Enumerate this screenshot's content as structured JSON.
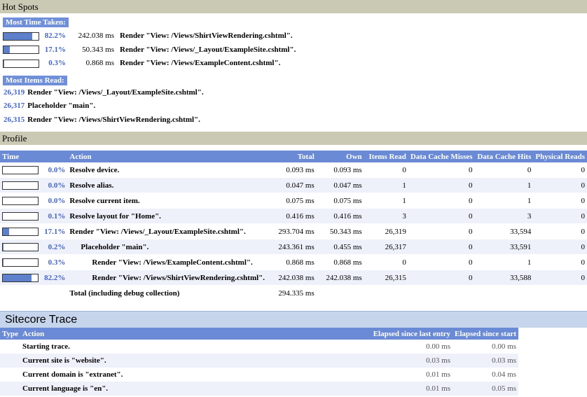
{
  "hotspots": {
    "title": "Hot Spots",
    "time_tag": "Most Time Taken:",
    "time_rows": [
      {
        "pct": "82.2%",
        "fill": 0.822,
        "ms": "242.038 ms",
        "label": "Render \"View: /Views/ShirtViewRendering.cshtml\"."
      },
      {
        "pct": "17.1%",
        "fill": 0.171,
        "ms": "50.343 ms",
        "label": "Render \"View: /Views/_Layout/ExampleSite.cshtml\"."
      },
      {
        "pct": "0.3%",
        "fill": 0.003,
        "ms": "0.868 ms",
        "label": "Render \"View: /Views/ExampleContent.cshtml\"."
      }
    ],
    "items_tag": "Most Items Read:",
    "items_rows": [
      {
        "count": "26,319",
        "label": "Render \"View: /Views/_Layout/ExampleSite.cshtml\"."
      },
      {
        "count": "26,317",
        "label": "Placeholder \"main\"."
      },
      {
        "count": "26,315",
        "label": "Render \"View: /Views/ShirtViewRendering.cshtml\"."
      }
    ]
  },
  "profile": {
    "title": "Profile",
    "headers": {
      "time": "Time",
      "action": "Action",
      "total": "Total",
      "own": "Own",
      "items_read": "Items Read",
      "cache_misses": "Data Cache Misses",
      "cache_hits": "Data Cache Hits",
      "physical_reads": "Physical Reads"
    },
    "rows": [
      {
        "pct": "0.0%",
        "fill": 0.0,
        "indent": 0,
        "action": "Resolve device.",
        "total": "0.093 ms",
        "own": "0.093 ms",
        "items": "0",
        "misses": "0",
        "hits": "0",
        "phys": "0"
      },
      {
        "pct": "0.0%",
        "fill": 0.0,
        "indent": 0,
        "action": "Resolve alias.",
        "total": "0.047 ms",
        "own": "0.047 ms",
        "items": "1",
        "misses": "0",
        "hits": "1",
        "phys": "0"
      },
      {
        "pct": "0.0%",
        "fill": 0.0,
        "indent": 0,
        "action": "Resolve current item.",
        "total": "0.075 ms",
        "own": "0.075 ms",
        "items": "1",
        "misses": "0",
        "hits": "1",
        "phys": "0"
      },
      {
        "pct": "0.1%",
        "fill": 0.001,
        "indent": 0,
        "action": "Resolve layout for \"Home\".",
        "total": "0.416 ms",
        "own": "0.416 ms",
        "items": "3",
        "misses": "0",
        "hits": "3",
        "phys": "0"
      },
      {
        "pct": "17.1%",
        "fill": 0.171,
        "indent": 0,
        "action": "Render \"View: /Views/_Layout/ExampleSite.cshtml\".",
        "total": "293.704 ms",
        "own": "50.343 ms",
        "items": "26,319",
        "misses": "0",
        "hits": "33,594",
        "phys": "0"
      },
      {
        "pct": "0.2%",
        "fill": 0.002,
        "indent": 1,
        "action": "Placeholder \"main\".",
        "total": "243.361 ms",
        "own": "0.455 ms",
        "items": "26,317",
        "misses": "0",
        "hits": "33,591",
        "phys": "0"
      },
      {
        "pct": "0.3%",
        "fill": 0.003,
        "indent": 2,
        "action": "Render \"View: /Views/ExampleContent.cshtml\".",
        "total": "0.868 ms",
        "own": "0.868 ms",
        "items": "0",
        "misses": "0",
        "hits": "1",
        "phys": "0"
      },
      {
        "pct": "82.2%",
        "fill": 0.822,
        "indent": 2,
        "action": "Render \"View: /Views/ShirtViewRendering.cshtml\".",
        "total": "242.038 ms",
        "own": "242.038 ms",
        "items": "26,315",
        "misses": "0",
        "hits": "33,588",
        "phys": "0"
      }
    ],
    "total_label": "Total (including debug collection)",
    "total_value": "294.335 ms"
  },
  "trace": {
    "title": "Sitecore Trace",
    "headers": {
      "type": "Type",
      "action": "Action",
      "elapsed_last": "Elapsed since last entry",
      "elapsed_start": "Elapsed since start"
    },
    "rows": [
      {
        "action": "Starting trace.",
        "last": "0.00 ms",
        "start": "0.00 ms"
      },
      {
        "action": "Current site is \"website\".",
        "last": "0.03 ms",
        "start": "0.03 ms"
      },
      {
        "action": "Current domain is \"extranet\".",
        "last": "0.01 ms",
        "start": "0.04 ms"
      },
      {
        "action": "Current language is \"en\".",
        "last": "0.01 ms",
        "start": "0.05 ms"
      }
    ]
  }
}
